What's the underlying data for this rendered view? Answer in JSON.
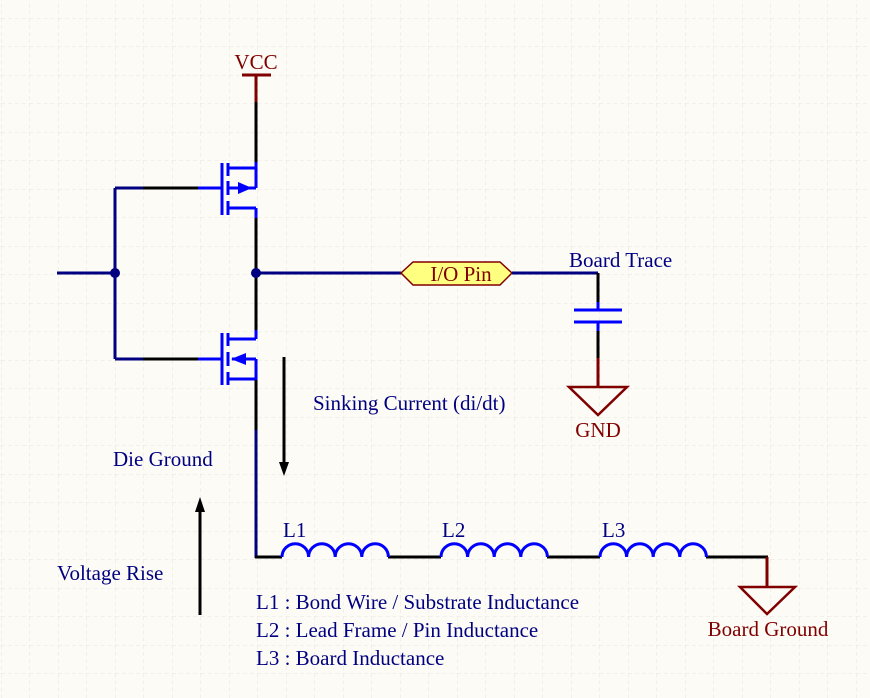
{
  "colors": {
    "background": "#fcfbf6",
    "wire": "#000000",
    "net": "#000080",
    "component": "#0000ff",
    "power": "#800000",
    "port_fill": "#ffff80"
  },
  "power": {
    "vcc": "VCC",
    "gnd": "GND",
    "board_ground": "Board Ground"
  },
  "port": {
    "label": "I/O Pin"
  },
  "labels": {
    "board_trace": "Board Trace",
    "sinking_current": "Sinking Current (di/dt)",
    "die_ground": "Die Ground",
    "voltage_rise": "Voltage Rise"
  },
  "inductors": [
    {
      "designator": "L1"
    },
    {
      "designator": "L2"
    },
    {
      "designator": "L3"
    }
  ],
  "legend": [
    "L1 : Bond Wire / Substrate Inductance",
    "L2 : Lead Frame / Pin Inductance",
    "L3 : Board Inductance"
  ]
}
